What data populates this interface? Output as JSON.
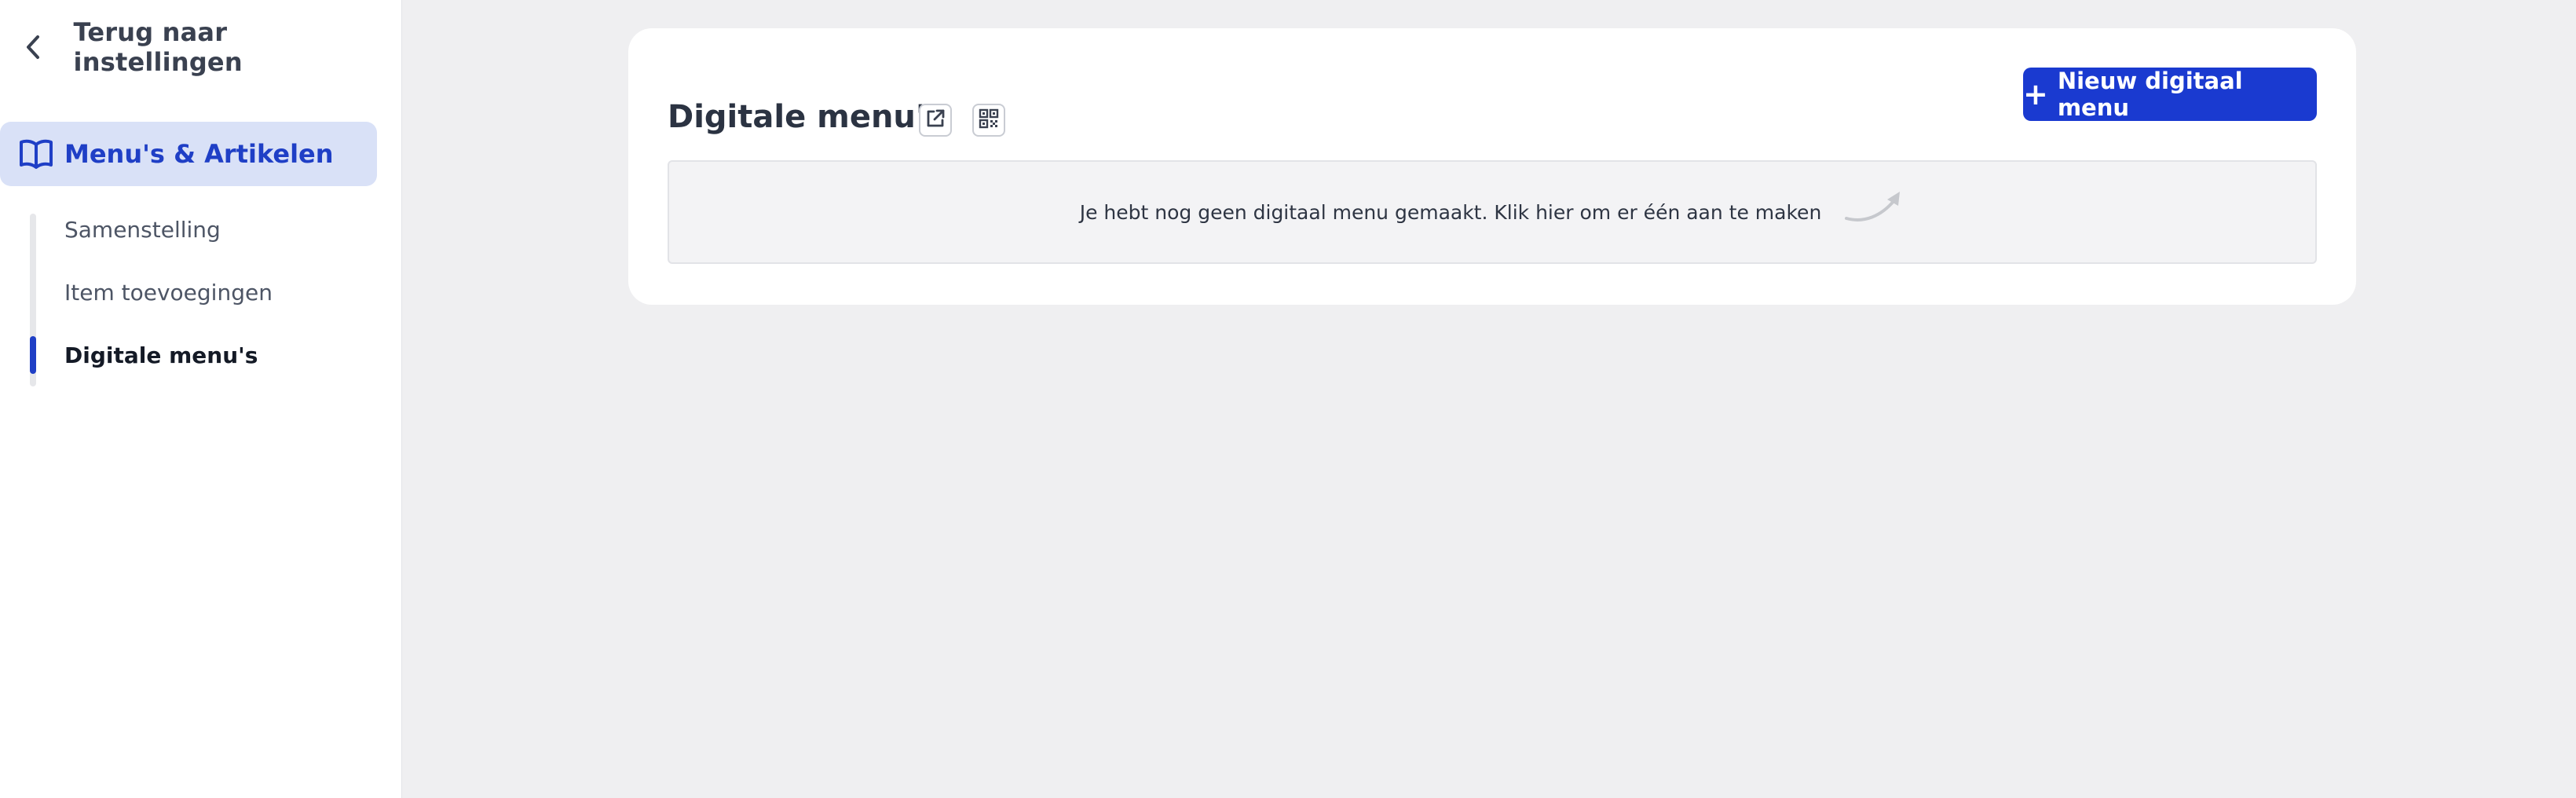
{
  "sidebar": {
    "back_label": "Terug naar instellingen",
    "active_section": {
      "label": "Menu's & Artikelen",
      "icon": "book-open-icon"
    },
    "items": [
      {
        "label": "Samenstelling",
        "active": false
      },
      {
        "label": "Item toevoegingen",
        "active": false
      },
      {
        "label": "Digitale menu's",
        "active": true
      }
    ]
  },
  "main": {
    "title": "Digitale menu's",
    "icons": [
      "external-link-icon",
      "qr-code-icon"
    ],
    "new_button_label": "Nieuw digitaal menu",
    "empty_message": "Je hebt nog geen digitaal menu gemaakt. Klik hier om er één aan te maken"
  },
  "colors": {
    "accent": "#1a3ad0",
    "active_bg": "#d9e1f7",
    "page_bg": "#efeff1"
  }
}
